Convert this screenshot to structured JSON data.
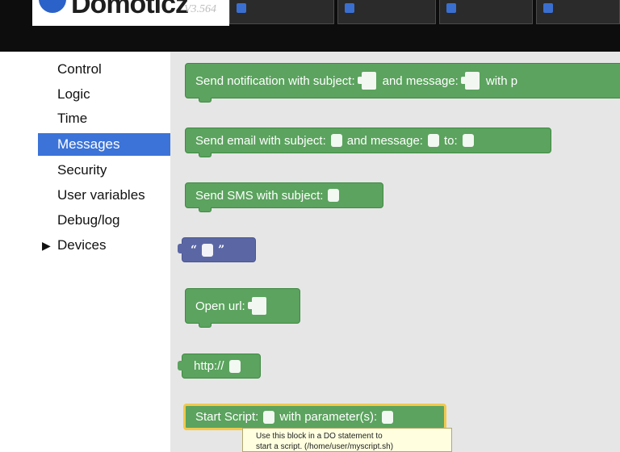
{
  "header": {
    "app_title": "Domoticz",
    "version": "V3.564"
  },
  "categories": [
    {
      "label": "Control",
      "selected": false
    },
    {
      "label": "Logic",
      "selected": false
    },
    {
      "label": "Time",
      "selected": false
    },
    {
      "label": "Messages",
      "selected": true
    },
    {
      "label": "Security",
      "selected": false
    },
    {
      "label": "User variables",
      "selected": false
    },
    {
      "label": "Debug/log",
      "selected": false
    },
    {
      "label": "Devices",
      "selected": false,
      "expandable": true,
      "arrow": "▶"
    }
  ],
  "blocks": {
    "notification": {
      "part1": "Send notification with subject:",
      "part2": "and message:",
      "part3": "with p"
    },
    "email": {
      "part1": "Send email with subject:",
      "part2": "and message:",
      "part3": "to:"
    },
    "sms": {
      "part1": "Send SMS with subject:"
    },
    "text": {
      "open_quote": "“",
      "close_quote": "”"
    },
    "open_url": {
      "label": "Open url:"
    },
    "http": {
      "label": "http://"
    },
    "start_script": {
      "part1": "Start Script:",
      "part2": "with parameter(s):"
    }
  },
  "tooltip": {
    "line1": "Use this block in a DO statement to",
    "line2": "start a script.  (/home/user/myscript.sh)"
  },
  "colors": {
    "topbar": "#0d0d0d",
    "selected_category": "#3b73d8",
    "green_block": "#5ba35e",
    "purple_block": "#5b67a5",
    "workspace": "#e6e6e6",
    "selection_outline": "#f2c94c"
  }
}
